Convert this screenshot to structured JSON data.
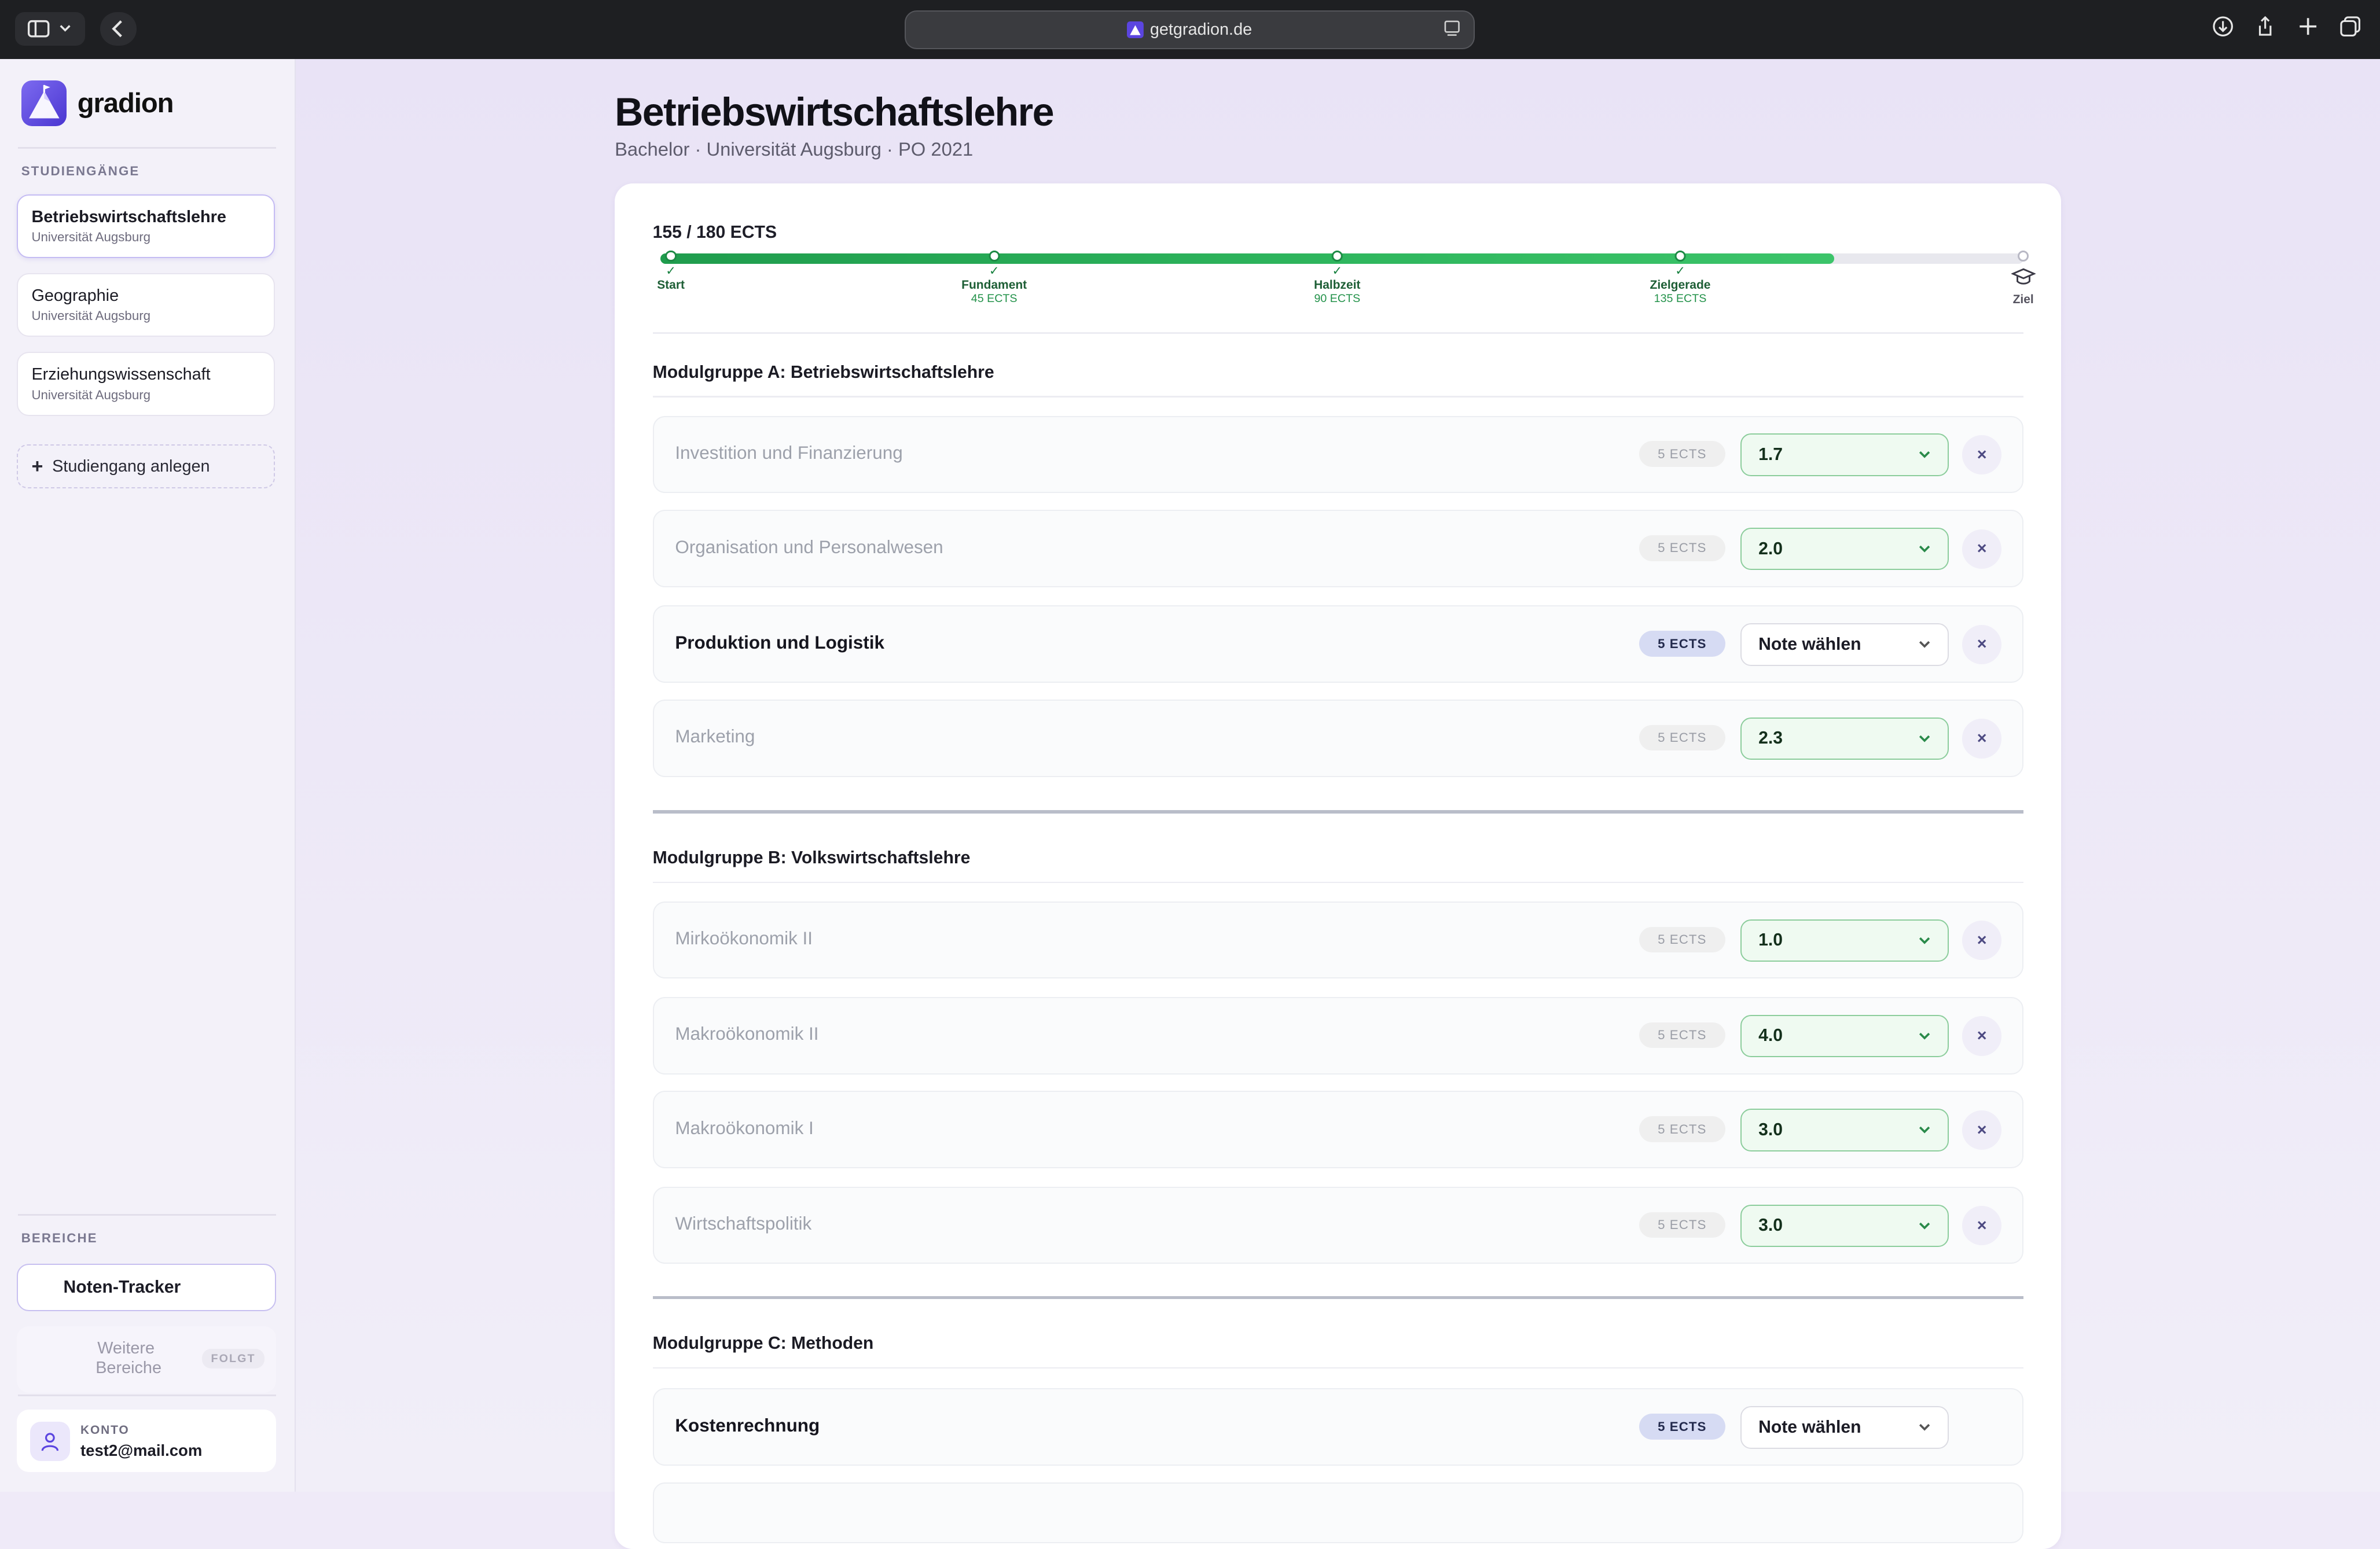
{
  "browser": {
    "url": "getgradion.de"
  },
  "sidebar": {
    "brand": "gradion",
    "courses_heading": "STUDIENGÄNGE",
    "courses": [
      {
        "title": "Betriebswirtschaftslehre",
        "subtitle": "Universität Augsburg",
        "active": true
      },
      {
        "title": "Geographie",
        "subtitle": "Universität Augsburg",
        "active": false
      },
      {
        "title": "Erziehungswissenschaft",
        "subtitle": "Universität Augsburg",
        "active": false
      }
    ],
    "add_course": "Studiengang anlegen",
    "areas_heading": "BEREICHE",
    "area_active": "Noten-Tracker",
    "area_soon": "Weitere Bereiche",
    "area_soon_badge": "FOLGT",
    "account_label": "KONTO",
    "account_email": "test2@mail.com"
  },
  "page": {
    "title": "Betriebswirtschaftslehre",
    "subtitle": "Bachelor · Universität Augsburg · PO 2021"
  },
  "progress": {
    "earned": 155,
    "total": 180,
    "label": "155 / 180 ECTS",
    "milestones": [
      {
        "label": "Start",
        "sub": "",
        "reached": true
      },
      {
        "label": "Fundament",
        "sub": "45 ECTS",
        "reached": true
      },
      {
        "label": "Halbzeit",
        "sub": "90 ECTS",
        "reached": true
      },
      {
        "label": "Zielgerade",
        "sub": "135 ECTS",
        "reached": true
      },
      {
        "label": "Ziel",
        "sub": "",
        "reached": false
      }
    ]
  },
  "groups": [
    {
      "title": "Modulgruppe A: Betriebswirtschaftslehre",
      "modules": [
        {
          "name": "Investition und Finanzierung",
          "ects": "5 ECTS",
          "grade": "1.7",
          "graded": true
        },
        {
          "name": "Organisation und Personalwesen",
          "ects": "5 ECTS",
          "grade": "2.0",
          "graded": true
        },
        {
          "name": "Produktion und Logistik",
          "ects": "5 ECTS",
          "grade": "Note wählen",
          "graded": false
        },
        {
          "name": "Marketing",
          "ects": "5 ECTS",
          "grade": "2.3",
          "graded": true
        }
      ]
    },
    {
      "title": "Modulgruppe B: Volkswirtschaftslehre",
      "modules": [
        {
          "name": "Mirkoökonomik II",
          "ects": "5 ECTS",
          "grade": "1.0",
          "graded": true
        },
        {
          "name": "Makroökonomik II",
          "ects": "5 ECTS",
          "grade": "4.0",
          "graded": true
        },
        {
          "name": "Makroökonomik I",
          "ects": "5 ECTS",
          "grade": "3.0",
          "graded": true
        },
        {
          "name": "Wirtschaftspolitik",
          "ects": "5 ECTS",
          "grade": "3.0",
          "graded": true
        }
      ]
    },
    {
      "title": "Modulgruppe C: Methoden",
      "modules": [
        {
          "name": "Kostenrechnung",
          "ects": "5 ECTS",
          "grade": "Note wählen",
          "graded": false
        }
      ]
    }
  ],
  "remove_label": "×",
  "colors": {
    "accent": "#5b45e0",
    "progress": "#2fb75e",
    "graded_bg": "#effaf1"
  }
}
